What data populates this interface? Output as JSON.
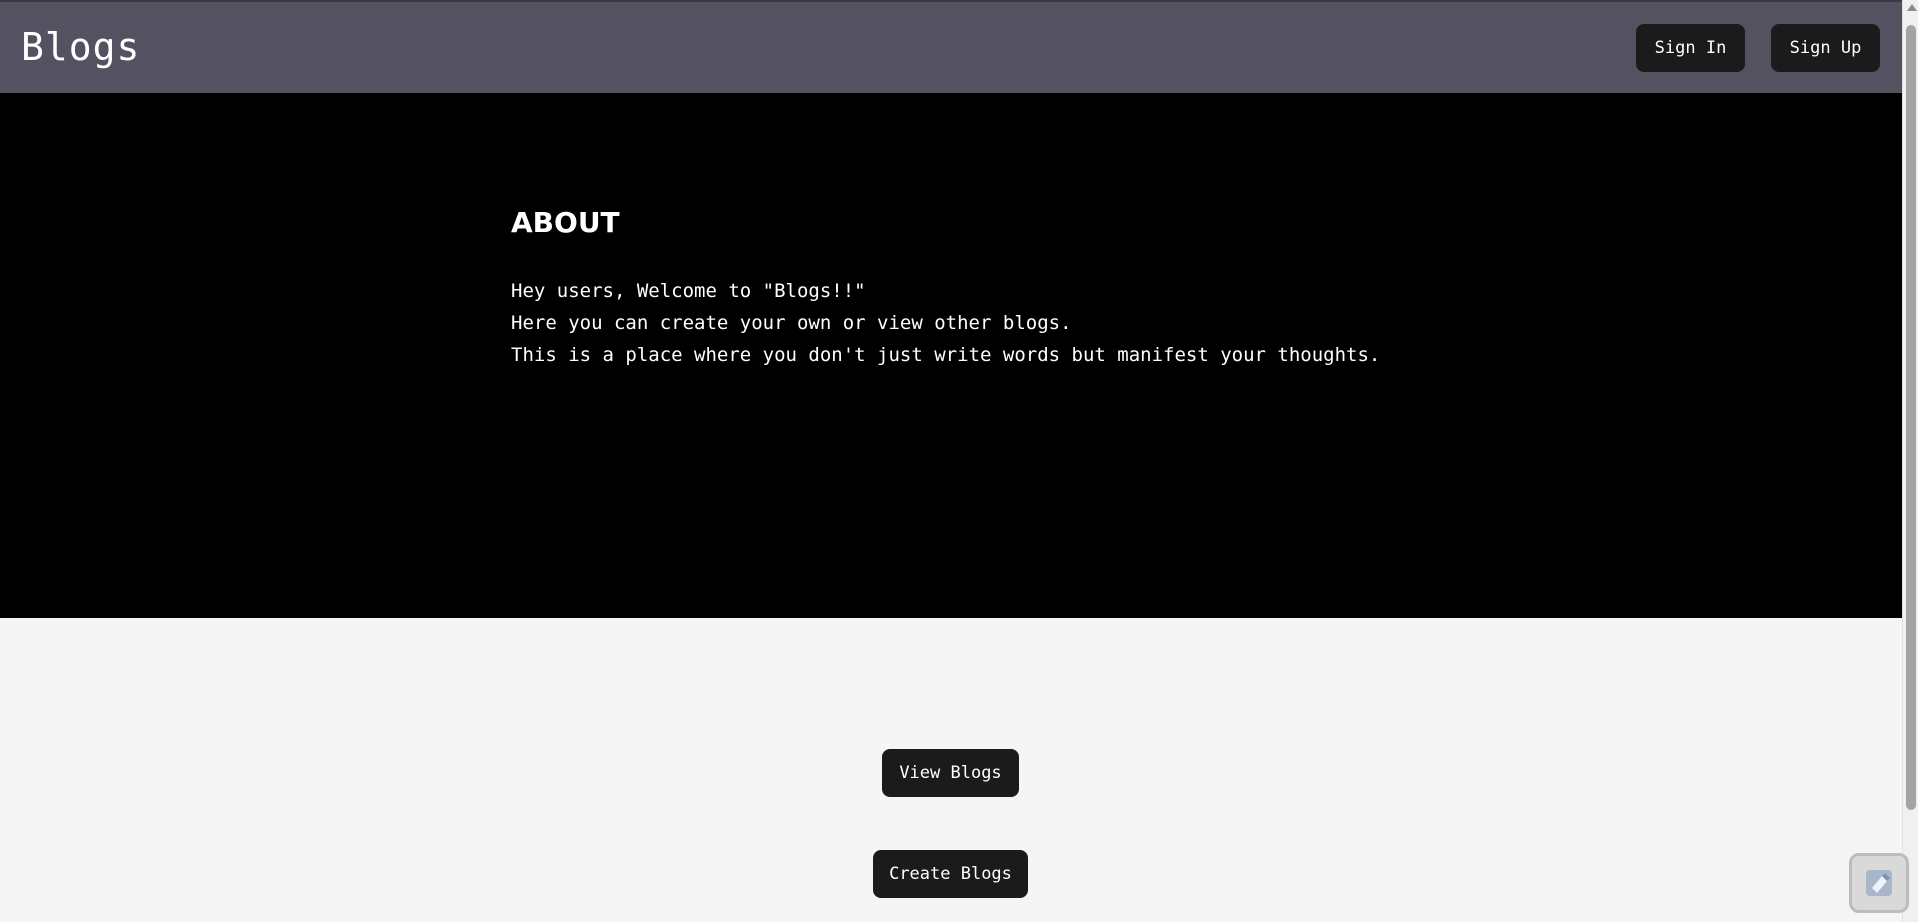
{
  "navbar": {
    "brand": "Blogs",
    "sign_in_label": "Sign In",
    "sign_up_label": "Sign Up"
  },
  "about": {
    "title": "ABOUT",
    "lines": [
      "Hey users, Welcome to \"Blogs!!\"",
      "Here you can create your own or view other blogs.",
      "This is a place where you don't just write words but manifest your thoughts."
    ]
  },
  "actions": {
    "view_label": "View Blogs",
    "create_label": "Create Blogs"
  },
  "colors": {
    "navbar_bg": "#545260",
    "hero_bg": "#000000",
    "button_bg": "#1b1b1b",
    "page_bg": "#f5f5f5"
  },
  "icons": {
    "floating_widget": "edit-extension-icon",
    "scroll_up": "chevron-up-icon"
  }
}
